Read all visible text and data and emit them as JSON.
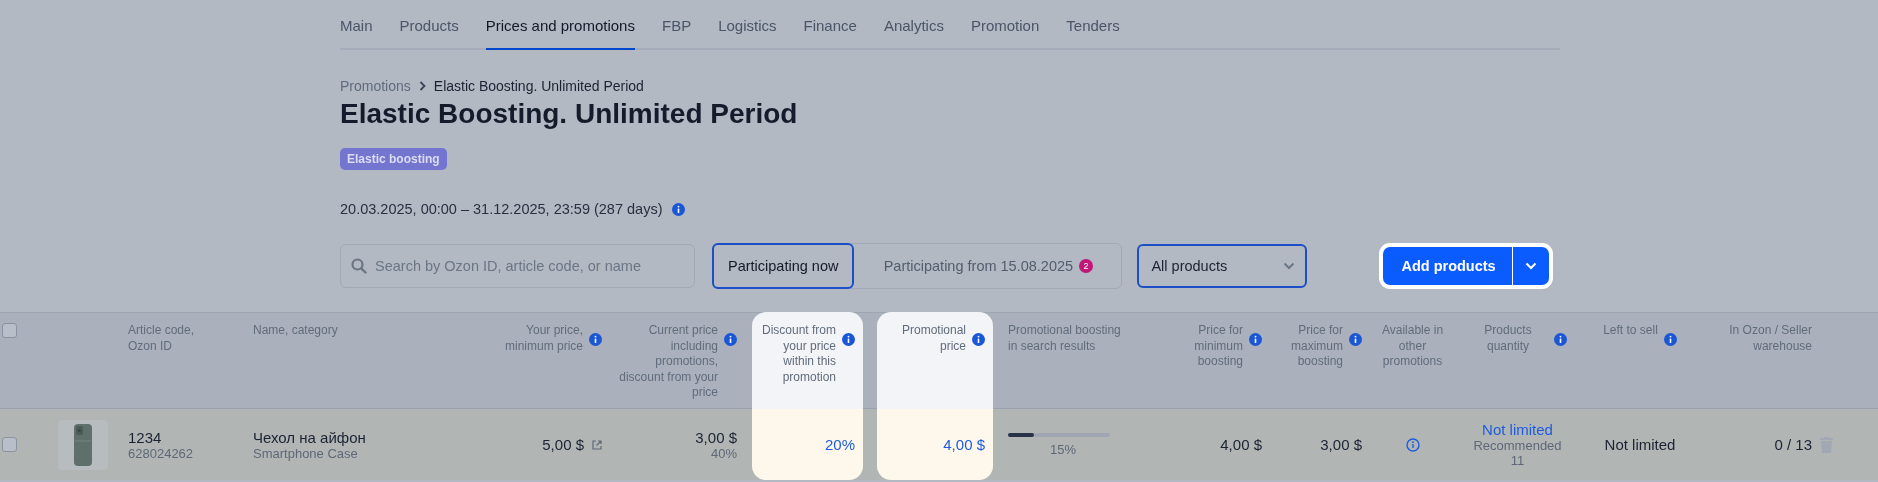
{
  "nav_tabs": [
    {
      "label": "Main",
      "selected": false
    },
    {
      "label": "Products",
      "selected": false
    },
    {
      "label": "Prices and promotions",
      "selected": true
    },
    {
      "label": "FBP",
      "selected": false
    },
    {
      "label": "Logistics",
      "selected": false
    },
    {
      "label": "Finance",
      "selected": false
    },
    {
      "label": "Analytics",
      "selected": false
    },
    {
      "label": "Promotion",
      "selected": false
    },
    {
      "label": "Tenders",
      "selected": false
    }
  ],
  "breadcrumb": {
    "parent": "Promotions",
    "current": "Elastic Boosting. Unlimited Period"
  },
  "title": "Elastic Boosting. Unlimited Period",
  "badge": "Elastic boosting",
  "period": "20.03.2025, 00:00 – 31.12.2025, 23:59 (287 days)",
  "search": {
    "placeholder": "Search by Ozon ID, article code, or name"
  },
  "segments": [
    {
      "label": "Participating now",
      "selected": true
    },
    {
      "label": "Participating from 15.08.2025",
      "selected": false,
      "count": "2"
    }
  ],
  "filter": {
    "value": "All products"
  },
  "add_button": {
    "label": "Add products",
    "highlighted": true
  },
  "table": {
    "header_checkbox": {
      "checked": false
    },
    "columns": [
      {
        "label": "Article code, Ozon ID",
        "info": false,
        "highlighted": false
      },
      {
        "label": "Name, category",
        "info": false,
        "highlighted": false
      },
      {
        "label": "Your price, minimum price",
        "info": true,
        "highlighted": false
      },
      {
        "label": "Current price including promotions, discount from your price",
        "info": true,
        "highlighted": false
      },
      {
        "label": "Discount from your price within this promotion",
        "info": true,
        "highlighted": true
      },
      {
        "label": "Promotional price",
        "info": true,
        "highlighted": true
      },
      {
        "label": "Promotional boosting in search results",
        "info": false,
        "highlighted": false
      },
      {
        "label": "Price for minimum boosting",
        "info": true,
        "highlighted": false
      },
      {
        "label": "Price for maximum boosting",
        "info": true,
        "highlighted": false
      },
      {
        "label": "Available in other promotions",
        "info": false,
        "highlighted": false
      },
      {
        "label": "Products quantity",
        "info": true,
        "highlighted": false
      },
      {
        "label": "Left to sell",
        "info": true,
        "highlighted": false
      },
      {
        "label": "In Ozon / Seller warehouse",
        "info": false,
        "highlighted": false
      }
    ],
    "rows": [
      {
        "checked": false,
        "article": "1234",
        "ozon_id": "628024262",
        "name": "Чехол на айфон",
        "category": "Smartphone Case",
        "your_price": "5,00 $",
        "current_price": "3,00 $",
        "current_discount": "40%",
        "discount": "20%",
        "promo_price": "4,00 $",
        "boosting": {
          "level": 0.25,
          "reading": "15%"
        },
        "min_boosting": "4,00 $",
        "max_boosting": "3,00 $",
        "quantity": "Not limited",
        "recommended_label": "Recommended",
        "recommended": "11",
        "left_to_sell": "Not limited",
        "warehouse": "0 / 13"
      }
    ]
  }
}
